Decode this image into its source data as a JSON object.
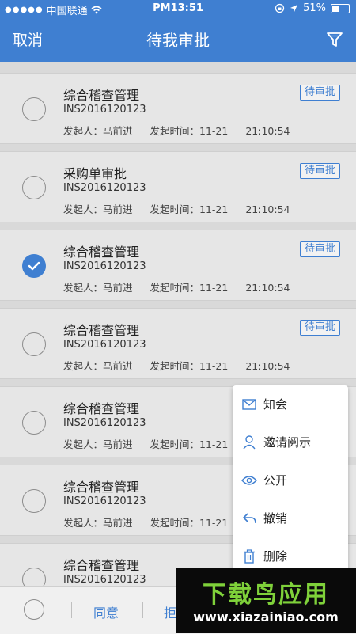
{
  "status_bar": {
    "carrier": "中国联通",
    "time": "PM13:51",
    "battery": "51%",
    "battery_level": 0.51
  },
  "nav": {
    "cancel": "取消",
    "title": "待我审批"
  },
  "items": [
    {
      "name": "综合稽查管理",
      "code": "INS2016120123",
      "initiator": "发起人：马前进",
      "time_label": "发起时间：11-21",
      "time": "21:10:54",
      "badge": "待审批",
      "checked": false
    },
    {
      "name": "采购单审批",
      "code": "INS2016120123",
      "initiator": "发起人：马前进",
      "time_label": "发起时间：11-21",
      "time": "21:10:54",
      "badge": "待审批",
      "checked": false
    },
    {
      "name": "综合稽查管理",
      "code": "INS2016120123",
      "initiator": "发起人：马前进",
      "time_label": "发起时间：11-21",
      "time": "21:10:54",
      "badge": "待审批",
      "checked": true
    },
    {
      "name": "综合稽查管理",
      "code": "INS2016120123",
      "initiator": "发起人：马前进",
      "time_label": "发起时间：11-21",
      "time": "21:10:54",
      "badge": "待审批",
      "checked": false
    },
    {
      "name": "综合稽查管理",
      "code": "INS2016120123",
      "initiator": "发起人：马前进",
      "time_label": "发起时间：11-21",
      "time": "",
      "badge": "",
      "checked": false
    },
    {
      "name": "综合稽查管理",
      "code": "INS2016120123",
      "initiator": "发起人：马前进",
      "time_label": "发起时间：11-21",
      "time": "",
      "badge": "",
      "checked": false
    },
    {
      "name": "综合稽查管理",
      "code": "INS2016120123",
      "initiator": "",
      "time_label": "",
      "time": "",
      "badge": "",
      "checked": false
    }
  ],
  "menu": [
    {
      "label": "知会",
      "icon": "mail-icon"
    },
    {
      "label": "邀请阅示",
      "icon": "person-icon"
    },
    {
      "label": "公开",
      "icon": "eye-icon"
    },
    {
      "label": "撤销",
      "icon": "undo-icon"
    },
    {
      "label": "删除",
      "icon": "trash-icon"
    }
  ],
  "bottom": {
    "agree": "同意",
    "reject": "拒"
  },
  "watermark": {
    "title": "下载鸟应用",
    "url": "www.xiazainiao.com"
  },
  "colors": {
    "accent": "#3f7fd1",
    "watermark_green": "#7fd13a"
  }
}
